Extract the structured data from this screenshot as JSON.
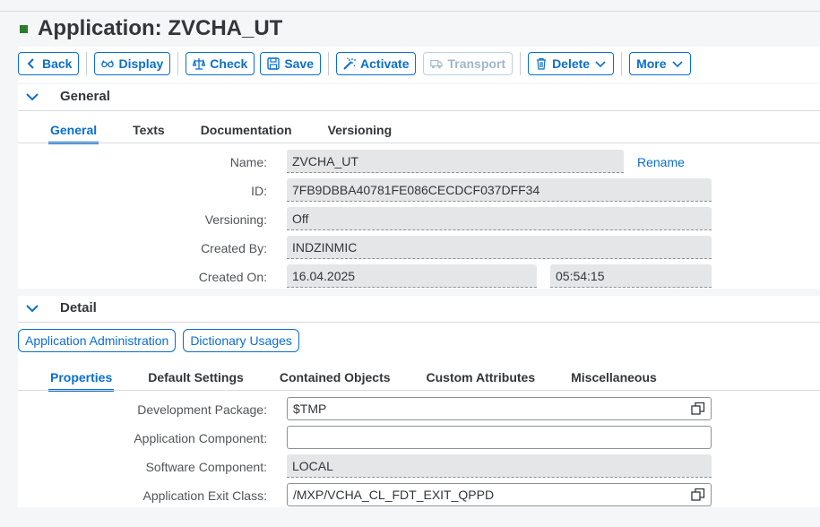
{
  "page": {
    "title": "Application: ZVCHA_UT"
  },
  "toolbar": {
    "back": "Back",
    "display": "Display",
    "check": "Check",
    "save": "Save",
    "activate": "Activate",
    "transport": "Transport",
    "delete": "Delete",
    "more": "More"
  },
  "general": {
    "section_title": "General",
    "tabs": [
      "General",
      "Texts",
      "Documentation",
      "Versioning"
    ],
    "fields": {
      "name_label": "Name:",
      "name_value": "ZVCHA_UT",
      "rename": "Rename",
      "id_label": "ID:",
      "id_value": "7FB9DBBA40781FE086CECDCF037DFF34",
      "versioning_label": "Versioning:",
      "versioning_value": "Off",
      "created_by_label": "Created By:",
      "created_by_value": "INDZINMIC",
      "created_on_label": "Created On:",
      "created_on_date": "16.04.2025",
      "created_on_time": "05:54:15"
    }
  },
  "detail": {
    "section_title": "Detail",
    "buttons": {
      "app_admin": "Application Administration",
      "dict_usages": "Dictionary Usages"
    },
    "tabs": [
      "Properties",
      "Default Settings",
      "Contained Objects",
      "Custom Attributes",
      "Miscellaneous"
    ],
    "fields": {
      "dev_package_label": "Development Package:",
      "dev_package_value": "$TMP",
      "app_component_label": "Application Component:",
      "app_component_value": "",
      "sw_component_label": "Software Component:",
      "sw_component_value": "LOCAL",
      "exit_class_label": "Application Exit Class:",
      "exit_class_value": "/MXP/VCHA_CL_FDT_EXIT_QPPD"
    }
  },
  "colors": {
    "accent": "#0a6ed1",
    "status": "#2b7d2b"
  }
}
